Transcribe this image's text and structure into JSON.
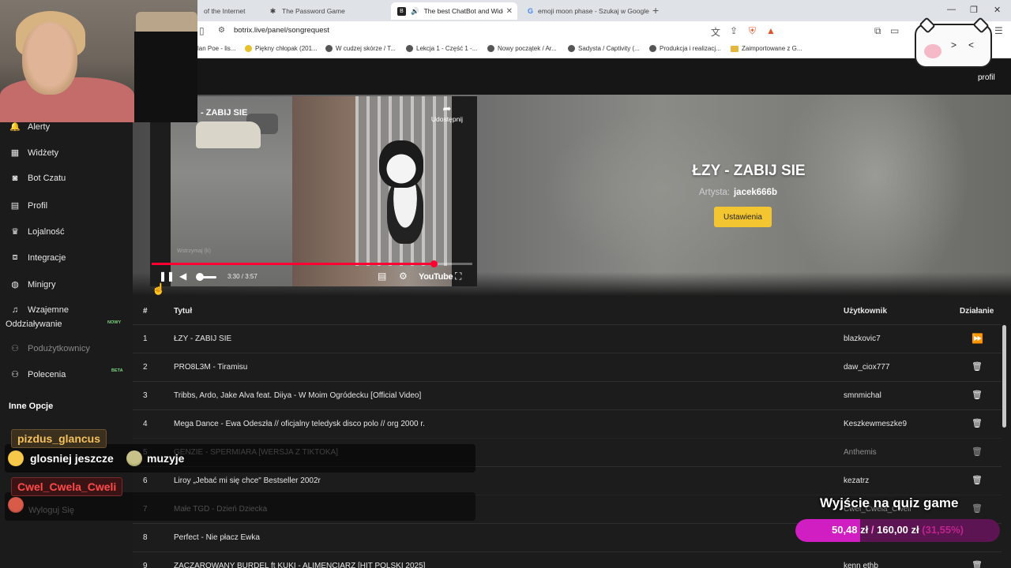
{
  "browser": {
    "tabs": [
      {
        "title": "of the Internet",
        "icon": ""
      },
      {
        "title": "The Password Game",
        "icon": "✱"
      },
      {
        "title": "The best ChatBot and Widget",
        "icon": "B"
      },
      {
        "title": "emoji moon phase - Szukaj w Google",
        "icon": "G"
      }
    ],
    "url": "botrix.live/panel/songrequest",
    "bookmarks": [
      "lan Poe - lis...",
      "Piękny chłopak (201...",
      "W cudzej skórze / T...",
      "Lekcja 1 - Część 1 -...",
      "Nowy początek / Ar...",
      "Sadysta / Captivity (...",
      "Produkcja i realizacj...",
      "Zaimportowane z G..."
    ]
  },
  "header": {
    "profile_link": "profil"
  },
  "sidebar": {
    "items": [
      {
        "label": "Alerty",
        "icon": "bell-icon"
      },
      {
        "label": "Widżety",
        "icon": "grid-icon"
      },
      {
        "label": "Bot Czatu",
        "icon": "robot-icon"
      },
      {
        "label": "Profil",
        "icon": "id-card-icon"
      },
      {
        "label": "Lojalność",
        "icon": "trophy-icon"
      },
      {
        "label": "Integracje",
        "icon": "plug-icon"
      },
      {
        "label": "Minigry",
        "icon": "gamepad-icon"
      },
      {
        "label": "Wzajemne",
        "label2": "Oddziaływanie",
        "icon": "music-icon",
        "badge": "NOWY"
      },
      {
        "label": "Podużytkownicy",
        "icon": "users-icon"
      },
      {
        "label": "Polecenia",
        "icon": "users-icon",
        "badge": "BETA"
      }
    ],
    "section_title": "Inne Opcje",
    "logout_label": "Wyloguj Się"
  },
  "now_playing": {
    "title": "ŁZY - ZABIJ SIE",
    "artist_label": "Artysta:",
    "artist": "jacek666b",
    "settings_button": "Ustawienia"
  },
  "video": {
    "title": "- ZABIJ SIE",
    "share_label": "Udostępnij",
    "watermark": "Wstrzymaj (k)",
    "time": "3:30 / 3:57",
    "progress": 0.88,
    "brand": "YouTube"
  },
  "table": {
    "headers": {
      "num": "#",
      "title": "Tytuł",
      "user": "Użytkownik",
      "action": "Działanie"
    },
    "rows": [
      {
        "num": "1",
        "title": "ŁZY - ZABIJ SIE",
        "user": "blazkovic7",
        "action": "skip-icon"
      },
      {
        "num": "2",
        "title": "PRO8L3M - Tiramisu",
        "user": "daw_ciox777",
        "action": "trash-icon"
      },
      {
        "num": "3",
        "title": "Tribbs, Ardo, Jake Alva feat. Diiya - W Moim Ogródecku [Official Video]",
        "user": "smnmichal",
        "action": "trash-icon"
      },
      {
        "num": "4",
        "title": "Mega Dance - Ewa Odeszła // oficjalny teledysk disco polo // org 2000 r.",
        "user": "Keszkewmeszke9",
        "action": "trash-icon"
      },
      {
        "num": "5",
        "title": "GENZIE - SPERMIARA [WERSJA Z TIKTOKA]",
        "user": "Anthemis",
        "action": "trash-icon"
      },
      {
        "num": "6",
        "title": "Liroy „Jebać mi się chce\" Bestseller 2002r",
        "user": "kezatrz",
        "action": "trash-icon"
      },
      {
        "num": "7",
        "title": "Małe TGD - Dzień Dziecka",
        "user": "Cwel_Cwela_Cweli",
        "action": "trash-icon"
      },
      {
        "num": "8",
        "title": "Perfect - Nie płacz Ewka",
        "user": "",
        "action": "trash-icon"
      },
      {
        "num": "9",
        "title": "ZACZAROWANY BURDEL ft KUKI - ALIMENCIARZ [HIT POLSKI 2025]",
        "user": "kenn ethb",
        "action": "trash-icon"
      }
    ]
  },
  "chat": {
    "user1": "pizdus_glancus",
    "msg1_a": "glosniej jeszcze",
    "msg1_b": "muzyje",
    "user2": "Cwel_Cwela_Cweli"
  },
  "goal": {
    "title": "Wyjście na quiz game",
    "current": "50,48 zł",
    "separator": "/",
    "target": "160,00 zł",
    "percent": "(31,55%)",
    "fraction": 0.3155
  },
  "colors": {
    "accent_yellow": "#f2c531",
    "progress_red": "#ff0033",
    "goal_pink": "#d11ec3",
    "badge_green": "#7cd47c"
  }
}
